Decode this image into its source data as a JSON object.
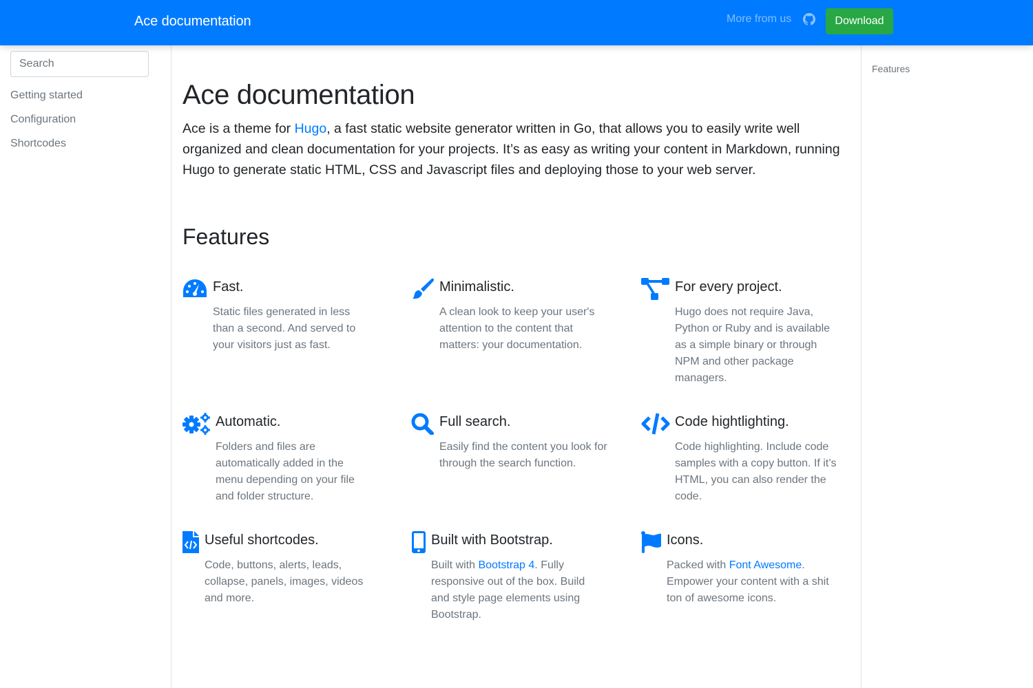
{
  "navbar": {
    "brand": "Ace documentation",
    "more_link": "More from us",
    "github_icon": "github-icon",
    "download_button": "Download"
  },
  "sidebar": {
    "search_placeholder": "Search",
    "search_value": "",
    "items": [
      {
        "label": "Getting started"
      },
      {
        "label": "Configuration"
      },
      {
        "label": "Shortcodes"
      }
    ]
  },
  "toc": {
    "items": [
      {
        "label": "Features"
      }
    ]
  },
  "main": {
    "title": "Ace documentation",
    "lead": {
      "before": "Ace is a theme for ",
      "link": "Hugo",
      "after": ", a fast static website generator written in Go, that allows you to easily write well organized and clean documentation for your projects. It’s as easy as writing your content in Markdown, running Hugo to generate static HTML, CSS and Javascript files and deploying those to your web server."
    },
    "features_heading": "Features",
    "features": [
      {
        "icon": "tachometer-icon",
        "title": "Fast.",
        "text": "Static files generated in less than a second. And served to your visitors just as fast."
      },
      {
        "icon": "paint-brush-icon",
        "title": "Minimalistic.",
        "text": "A clean look to keep your user's attention to the content that matters: your documentation."
      },
      {
        "icon": "project-diagram-icon",
        "title": "For every project.",
        "text": "Hugo does not require Java, Python or Ruby and is available as a simple binary or through NPM and other package managers."
      },
      {
        "icon": "cogs-icon",
        "title": "Automatic.",
        "text": "Folders and files are automatically added in the menu depending on your file and folder structure."
      },
      {
        "icon": "search-icon",
        "title": "Full search.",
        "text": "Easily find the content you look for through the search function."
      },
      {
        "icon": "code-icon",
        "title": "Code hightlighting.",
        "text": "Code highlighting. Include code samples with a copy button. If it’s HTML, you can also render the code."
      },
      {
        "icon": "file-code-icon",
        "title": "Useful shortcodes.",
        "text": "Code, buttons, alerts, leads, collapse, panels, images, videos and more."
      },
      {
        "icon": "mobile-icon",
        "title": "Built with Bootstrap.",
        "text_before": "Built with ",
        "link": "Bootstrap 4",
        "text_after": ". Fully responsive out of the box. Build and style page elements using Bootstrap."
      },
      {
        "icon": "flag-icon",
        "title": "Icons.",
        "text_before": "Packed with ",
        "link": "Font Awesome",
        "text_after": ". Empower your content with a shit ton of awesome icons."
      }
    ]
  },
  "colors": {
    "primary": "#007bff",
    "success": "#28a745",
    "text": "#212529",
    "muted": "#6c757d"
  }
}
